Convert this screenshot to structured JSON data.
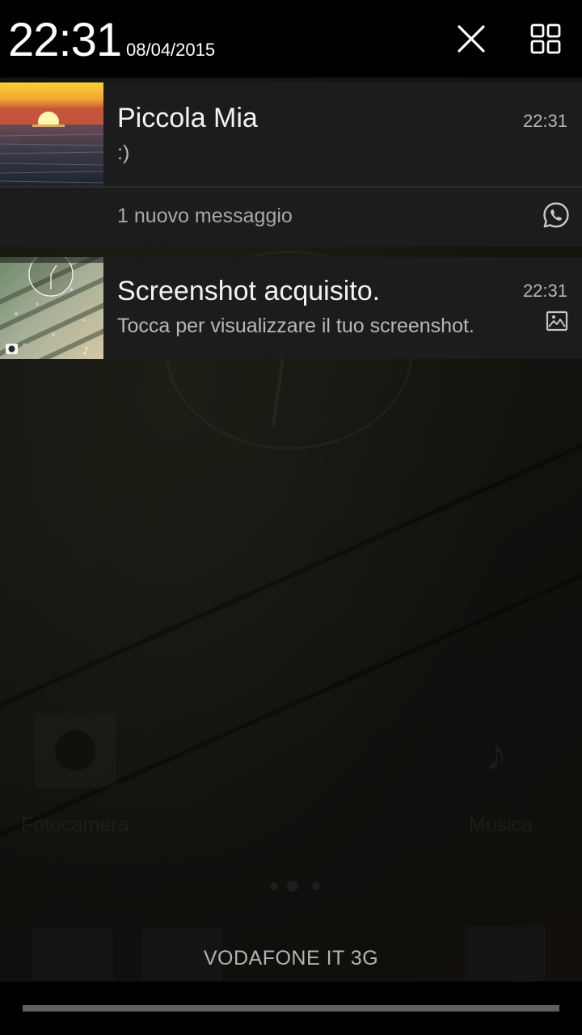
{
  "status": {
    "time": "22:31",
    "date": "08/04/2015"
  },
  "header_actions": {
    "close_icon": "close-icon",
    "settings_icon": "quick-settings-grid-icon"
  },
  "notifications": [
    {
      "app": "WhatsApp",
      "title": "Piccola Mia",
      "text": ":)",
      "time": "22:31",
      "summary": "1 nuovo messaggio",
      "app_icon": "whatsapp-icon",
      "thumbnail": "sunset-sea-photo"
    },
    {
      "title": "Screenshot acquisito.",
      "text": "Tocca per visualizzare il tuo screenshot.",
      "time": "22:31",
      "app_icon": "image-icon",
      "thumbnail": "screenshot-preview"
    }
  ],
  "background": {
    "dock_labels": [
      "Fotocamera",
      "Musica"
    ]
  },
  "carrier": "VODAFONE IT 3G"
}
